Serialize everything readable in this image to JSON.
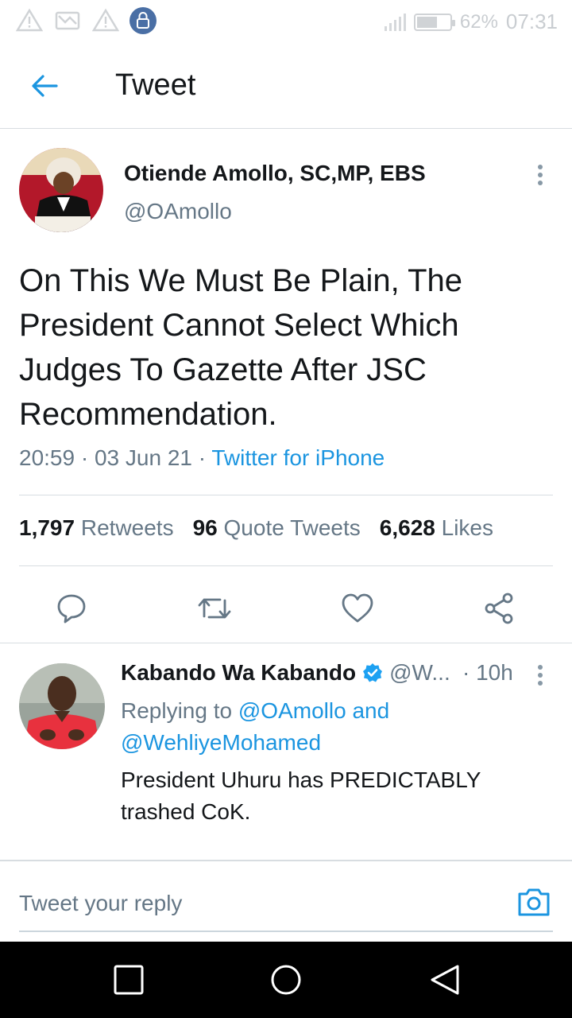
{
  "status_bar": {
    "battery_percent": "62%",
    "battery_level": 0.62,
    "time": "07:31",
    "icons": [
      "warning-icon",
      "missed-call-icon",
      "warning-icon",
      "vpn-lock-icon",
      "signal-icon",
      "battery-icon"
    ]
  },
  "header": {
    "back_icon": "arrow-left-icon",
    "title": "Tweet"
  },
  "tweet": {
    "author_name": "Otiende Amollo, SC,MP, EBS",
    "author_handle": "@OAmollo",
    "text": "On This We Must Be Plain, The President Cannot Select Which Judges To Gazette After JSC Recommendation.",
    "time": "20:59",
    "separator": "·",
    "date": "03 Jun 21",
    "source": "Twitter for iPhone",
    "stats": {
      "retweets_count": "1,797",
      "retweets_label": "Retweets",
      "quotes_count": "96",
      "quotes_label": "Quote Tweets",
      "likes_count": "6,628",
      "likes_label": "Likes"
    },
    "actions": [
      "reply-icon",
      "retweet-icon",
      "like-icon",
      "share-icon"
    ]
  },
  "reply": {
    "author_name": "Kabando Wa Kabando",
    "author_handle": "@W...",
    "time": "· 10h",
    "replying_prefix": "Replying to",
    "mention_1": "@OAmollo",
    "replying_and": "and",
    "mention_2": "@WehliyeMohamed",
    "text": "President Uhuru has PREDICTABLY trashed CoK."
  },
  "composer": {
    "placeholder": "Tweet your reply",
    "camera_icon": "camera-icon"
  },
  "nav_bar": {
    "icons": [
      "recents-square-icon",
      "home-circle-icon",
      "back-triangle-icon"
    ]
  },
  "colors": {
    "accent": "#1b95e0",
    "text": "#14171a",
    "secondary": "#657786",
    "divider": "#d8dde1"
  }
}
